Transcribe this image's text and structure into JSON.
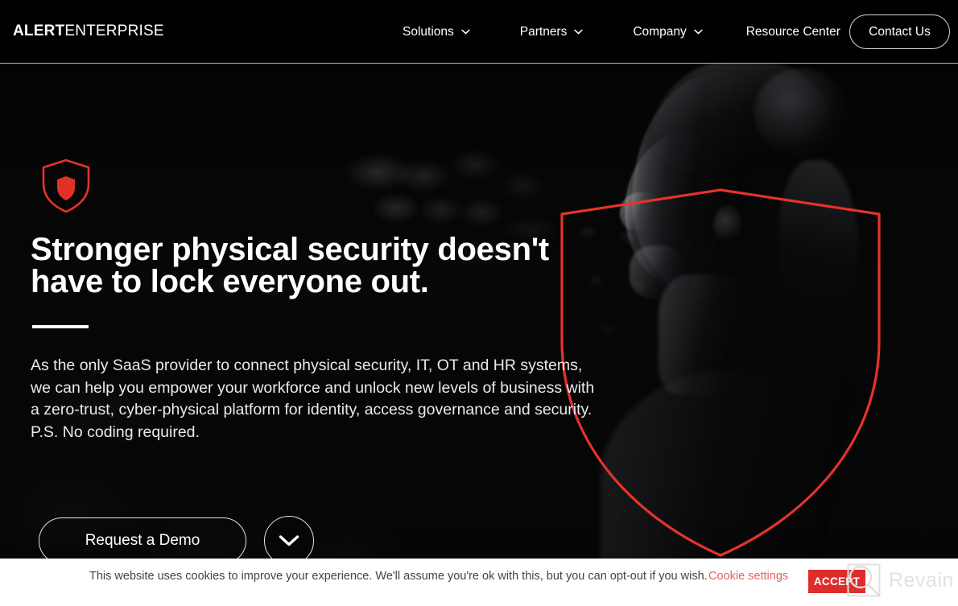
{
  "header": {
    "logo": {
      "part1": "ALERT",
      "part2": "ENTERPRISE"
    },
    "nav": [
      {
        "label": "Solutions",
        "icon": "chevron-down-icon",
        "has_dropdown": true
      },
      {
        "label": "Partners",
        "icon": "chevron-down-icon",
        "has_dropdown": true
      },
      {
        "label": "Company",
        "icon": "chevron-down-icon",
        "has_dropdown": true
      },
      {
        "label": "Resource Center",
        "has_dropdown": false
      }
    ],
    "contact_button": "Contact Us"
  },
  "hero": {
    "badge_icon": "shield-icon",
    "headline": "Stronger physical security doesn't have to lock everyone out.",
    "body": "As the only SaaS provider to connect physical security, IT, OT and HR systems, we can help you empower your workforce and unlock new levels of business with a zero-trust, cyber-physical platform for identity, access governance and security. P.S. No coding required.",
    "primary_button": "Request a Demo",
    "scroll_icon": "chevron-down-icon",
    "overlay_icon": "shield-outline-icon"
  },
  "cookie_banner": {
    "message": "This website uses cookies to improve your experience. We'll assume you're ok with this, but you can opt-out if you wish.",
    "settings_link": "Cookie settings",
    "accept_button": "ACCEPT"
  },
  "watermark": {
    "text": "Revain",
    "icon": "revain-logo-icon"
  },
  "colors": {
    "brand_red": "#e5332a",
    "accept_red": "#e02b2b",
    "cookie_link": "#e06363",
    "header_bg": "#000000",
    "banner_bg": "#ffffff",
    "text_light": "#ffffff"
  }
}
